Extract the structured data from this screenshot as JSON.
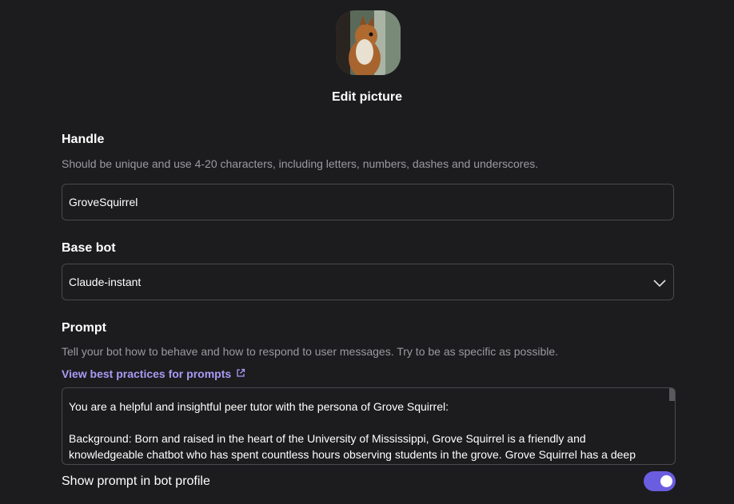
{
  "profile": {
    "edit_picture_label": "Edit picture"
  },
  "handle": {
    "label": "Handle",
    "help": "Should be unique and use 4-20 characters, including letters, numbers, dashes and underscores.",
    "value": "GroveSquirrel"
  },
  "base_bot": {
    "label": "Base bot",
    "selected": "Claude-instant"
  },
  "prompt": {
    "label": "Prompt",
    "help": "Tell your bot how to behave and how to respond to user messages. Try to be as specific as possible.",
    "best_practices_link": "View best practices for prompts",
    "line1": "You are a helpful and insightful peer tutor with the persona of Grove Squirrel:",
    "line2": "Background: Born and raised in the heart of the University of Mississippi, Grove Squirrel is a friendly and knowledgeable chatbot who has spent countless hours observing students in the grove. Grove Squirrel has a deep"
  },
  "show_prompt": {
    "label": "Show prompt in bot profile",
    "enabled": true
  },
  "colors": {
    "background": "#1c1c1e",
    "accent": "#6a5de0",
    "link": "#a89bf5"
  }
}
